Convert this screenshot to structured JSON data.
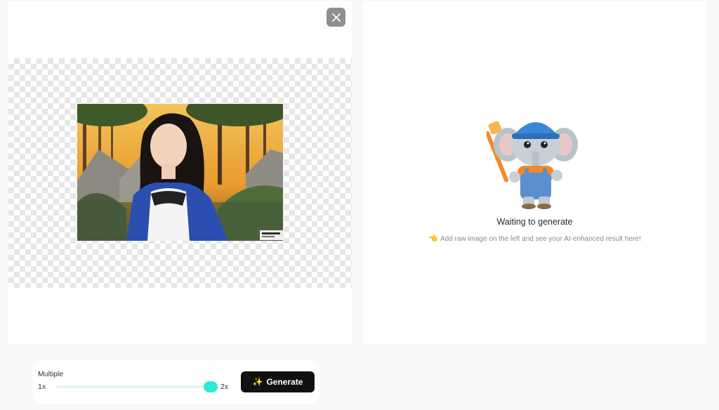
{
  "left": {
    "close_icon": "close-icon",
    "image_alt": "uploaded-photo"
  },
  "right": {
    "status_title": "Waiting to generate",
    "status_hint_icon": "👈",
    "status_hint": "Add raw image on the left and see your AI-enhanced result here!"
  },
  "controls": {
    "multiple_label": "Multiple",
    "min_label": "1x",
    "max_label": "2x",
    "slider_value_fraction": 1.0,
    "generate_icon": "✨",
    "generate_label": "Generate"
  },
  "colors": {
    "accent": "#2ee8d6",
    "button": "#111111"
  }
}
